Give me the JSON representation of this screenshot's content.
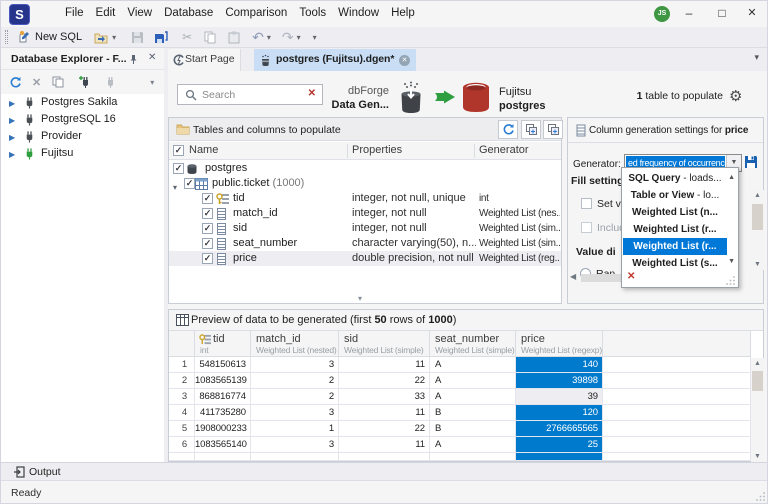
{
  "window": {
    "logo_letter": "S",
    "user_badge": "JS",
    "minimize": "–",
    "maximize": "□",
    "close": "✕"
  },
  "menu": {
    "items": [
      "File",
      "Edit",
      "View",
      "Database",
      "Comparison",
      "Tools",
      "Window",
      "Help"
    ]
  },
  "toolbar": {
    "new_sql_label": "New SQL"
  },
  "sidebar": {
    "title": "Database Explorer - F...",
    "items": [
      {
        "label": "Postgres Sakila",
        "plug_color": "#4a4f55"
      },
      {
        "label": "PostgreSQL 16",
        "plug_color": "#4a4f55"
      },
      {
        "label": "Provider",
        "plug_color": "#4a4f55"
      },
      {
        "label": "Fujitsu",
        "plug_color": "#2f9e3f"
      }
    ]
  },
  "tabs": {
    "start_page": "Start Page",
    "active_doc": "postgres (Fujitsu).dgen*"
  },
  "connection_bar": {
    "search_placeholder": "Search",
    "product_line1": "dbForge",
    "product_line2": "Data Gen...",
    "server": "Fujitsu",
    "database": "postgres",
    "summary_count": "1",
    "summary_rest": " table to populate"
  },
  "tables_panel": {
    "title": "Tables and columns to populate",
    "columns": {
      "name": "Name",
      "properties": "Properties",
      "generator": "Generator"
    },
    "rows": [
      {
        "kind": "db",
        "name": "postgres",
        "suffix": "",
        "props": "",
        "gen": ""
      },
      {
        "kind": "table",
        "name": "public.ticket",
        "suffix": " (1000)",
        "props": "",
        "gen": ""
      },
      {
        "kind": "key",
        "name": "tid",
        "suffix": "",
        "props": "integer, not null, unique",
        "gen": "int"
      },
      {
        "kind": "col",
        "name": "match_id",
        "suffix": "",
        "props": "integer, not null",
        "gen": "Weighted List (nes..."
      },
      {
        "kind": "col",
        "name": "sid",
        "suffix": "",
        "props": "integer, not null",
        "gen": "Weighted List (sim..."
      },
      {
        "kind": "col",
        "name": "seat_number",
        "suffix": "",
        "props": "character varying(50), n...",
        "gen": "Weighted List (sim..."
      },
      {
        "kind": "col",
        "name": "price",
        "suffix": "",
        "props": "double precision, not null",
        "gen": "Weighted List (reg...",
        "selected": true
      }
    ]
  },
  "generator_panel": {
    "title_prefix": "Column generation settings for ",
    "title_column": "price",
    "generator_label": "Generator:",
    "generator_value": "ed frequency of occurrence",
    "fill_settings_label": "Fill setting",
    "set_value_label": "Set v",
    "include_label": "Includ",
    "value_dist_label": "Value di",
    "random_label": "Ran",
    "dropdown_items": [
      {
        "bold": "SQL Query",
        "rest": " - loads..."
      },
      {
        "bold": "Table or View",
        "rest": " - lo..."
      },
      {
        "bold": "Weighted List (n...",
        "rest": ""
      },
      {
        "bold": "Weighted List (r...",
        "rest": ""
      },
      {
        "bold": "Weighted List (r...",
        "rest": "",
        "selected": true
      },
      {
        "bold": "Weighted List (s...",
        "rest": ""
      }
    ]
  },
  "preview_panel": {
    "title_p1": "Preview of data to be generated (first ",
    "title_b1": "50",
    "title_p2": " rows of ",
    "title_b2": "1000",
    "title_p3": ")",
    "columns": [
      {
        "name": "tid",
        "type": "int",
        "key": true
      },
      {
        "name": "match_id",
        "type": "Weighted List (nested)"
      },
      {
        "name": "sid",
        "type": "Weighted List (simple)"
      },
      {
        "name": "seat_number",
        "type": "Weighted List (simple)"
      },
      {
        "name": "price",
        "type": "Weighted List (regexp)"
      }
    ],
    "rows": [
      {
        "n": "1",
        "tid": "548150613",
        "match_id": "3",
        "sid": "11",
        "seat": "A",
        "price": "140",
        "price_hl": true
      },
      {
        "n": "2",
        "tid": "1083565139",
        "match_id": "2",
        "sid": "22",
        "seat": "A",
        "price": "39898",
        "price_hl": true
      },
      {
        "n": "3",
        "tid": "868816774",
        "match_id": "2",
        "sid": "33",
        "seat": "A",
        "price": "39",
        "price_hl": false
      },
      {
        "n": "4",
        "tid": "411735280",
        "match_id": "3",
        "sid": "11",
        "seat": "B",
        "price": "120",
        "price_hl": true
      },
      {
        "n": "5",
        "tid": "1908000233",
        "match_id": "1",
        "sid": "22",
        "seat": "B",
        "price": "2766665565",
        "price_hl": true
      },
      {
        "n": "6",
        "tid": "1083565140",
        "match_id": "3",
        "sid": "11",
        "seat": "A",
        "price": "25",
        "price_hl": true
      }
    ]
  },
  "output_bar": {
    "label": "Output"
  },
  "status_bar": {
    "text": "Ready"
  }
}
